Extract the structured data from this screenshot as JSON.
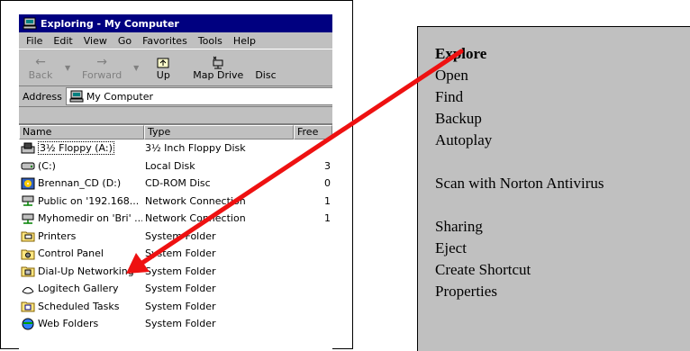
{
  "window": {
    "title": "Exploring - My Computer",
    "menu": [
      "File",
      "Edit",
      "View",
      "Go",
      "Favorites",
      "Tools",
      "Help"
    ],
    "toolbar": {
      "back": "Back",
      "forward": "Forward",
      "up": "Up",
      "map_drive": "Map Drive",
      "disconnect": "Disc"
    },
    "address_label": "Address",
    "address_value": "My Computer",
    "columns": [
      "Name",
      "Type",
      "Free"
    ],
    "rows": [
      {
        "name": "3½ Floppy (A:)",
        "type": "3½ Inch Floppy Disk",
        "free": "",
        "icon": "floppy-drive-icon"
      },
      {
        "name": "(C:)",
        "type": "Local Disk",
        "free": "3",
        "icon": "hard-disk-icon"
      },
      {
        "name": "Brennan_CD (D:)",
        "type": "CD-ROM Disc",
        "free": "0",
        "icon": "cd-rom-icon"
      },
      {
        "name": "Public on '192.168...",
        "type": "Network Connection",
        "free": "1",
        "icon": "network-drive-icon"
      },
      {
        "name": "Myhomedir on 'Bri' ...",
        "type": "Network Connection",
        "free": "1",
        "icon": "network-drive-icon"
      },
      {
        "name": "Printers",
        "type": "System Folder",
        "free": "",
        "icon": "printers-folder-icon"
      },
      {
        "name": "Control Panel",
        "type": "System Folder",
        "free": "",
        "icon": "control-panel-icon"
      },
      {
        "name": "Dial-Up Networking",
        "type": "System Folder",
        "free": "",
        "icon": "dial-up-networking-icon"
      },
      {
        "name": "Logitech Gallery",
        "type": "System Folder",
        "free": "",
        "icon": "logitech-gallery-icon"
      },
      {
        "name": "Scheduled Tasks",
        "type": "System Folder",
        "free": "",
        "icon": "scheduled-tasks-icon"
      },
      {
        "name": "Web Folders",
        "type": "System Folder",
        "free": "",
        "icon": "web-folders-icon"
      }
    ]
  },
  "context_menu": {
    "items": [
      {
        "label": "Explore",
        "bold": true
      },
      {
        "label": "Open"
      },
      {
        "label": "Find"
      },
      {
        "label": "Backup"
      },
      {
        "label": "Autoplay"
      },
      {
        "label": "Scan with Norton Antivirus"
      },
      {
        "label": "Sharing"
      },
      {
        "label": "Eject"
      },
      {
        "label": "Create Shortcut"
      },
      {
        "label": "Properties"
      }
    ]
  },
  "colors": {
    "title_bar": "#000080",
    "window_face": "#c0c0c0",
    "arrow": "#ee1111"
  }
}
